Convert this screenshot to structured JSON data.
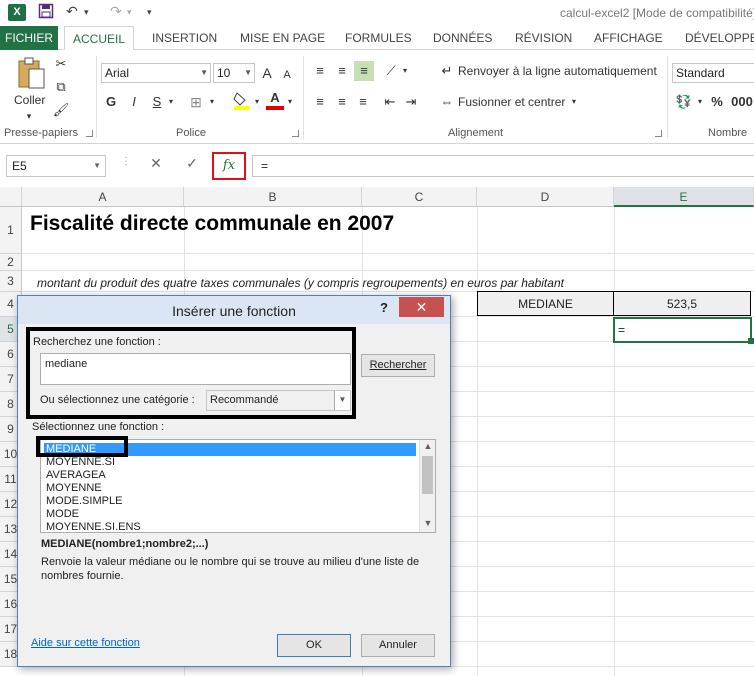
{
  "app": {
    "logo": "X",
    "doc_title": "calcul-excel2  [Mode de compatibilité]"
  },
  "quick_access": {
    "save_icon": "save-icon",
    "undo_icon": "undo-icon",
    "redo_icon": "redo-icon",
    "customize_icon": "chevron-down-icon"
  },
  "tabs": [
    "FICHIER",
    "ACCUEIL",
    "INSERTION",
    "MISE EN PAGE",
    "FORMULES",
    "DONNÉES",
    "RÉVISION",
    "AFFICHAGE",
    "DÉVELOPPEU"
  ],
  "ribbon": {
    "clipboard": {
      "paste_label": "Coller",
      "group_label": "Presse-papiers"
    },
    "font": {
      "font_name": "Arial",
      "font_size": "10",
      "bold": "G",
      "italic": "I",
      "underline": "S",
      "grow": "A",
      "shrink": "A",
      "font_color": "A",
      "group_label": "Police"
    },
    "alignment": {
      "wrap_label": "Renvoyer à la ligne automatiquement",
      "merge_label": "Fusionner et centrer",
      "group_label": "Alignement"
    },
    "number": {
      "format": "Standard",
      "percent": "%",
      "thousands": "000",
      "group_label": "Nombre"
    }
  },
  "formula_bar": {
    "name_box": "E5",
    "cancel": "✕",
    "enter": "✓",
    "fx": "fx",
    "content": "="
  },
  "grid": {
    "columns": [
      "A",
      "B",
      "C",
      "D",
      "E"
    ],
    "rows": [
      "1",
      "2",
      "3",
      "4",
      "5",
      "6",
      "7",
      "8",
      "9",
      "10",
      "11",
      "12",
      "13",
      "14",
      "15",
      "16",
      "17",
      "18"
    ],
    "title": "Fiscalité directe communale en 2007",
    "subtitle": "montant du produit des quatre taxes communales (y compris regroupements) en euros par habitant",
    "d4": "MEDIANE",
    "e4": "523,5",
    "e5": "="
  },
  "dialog": {
    "title": "Insérer une fonction",
    "help": "?",
    "close": "✕",
    "search_label": "Recherchez une fonction :",
    "search_value": "mediane",
    "search_button": "Rechercher",
    "category_label": "Ou sélectionnez une catégorie :",
    "category_value": "Recommandé",
    "select_label": "Sélectionnez une fonction :",
    "functions": [
      "MEDIANE",
      "MOYENNE.SI",
      "AVERAGEA",
      "MOYENNE",
      "MODE.SIMPLE",
      "MODE",
      "MOYENNE.SI.ENS"
    ],
    "selected_index": 0,
    "syntax": "MEDIANE(nombre1;nombre2;...)",
    "description": "Renvoie la valeur médiane ou le nombre qui se trouve au milieu d'une liste de nombres fournie.",
    "help_link": "Aide sur cette fonction",
    "ok": "OK",
    "cancel": "Annuler"
  },
  "colors": {
    "excel_green": "#217346",
    "highlight_red": "#e0101a",
    "selection_blue": "#3399ff",
    "close_red": "#c75050"
  }
}
